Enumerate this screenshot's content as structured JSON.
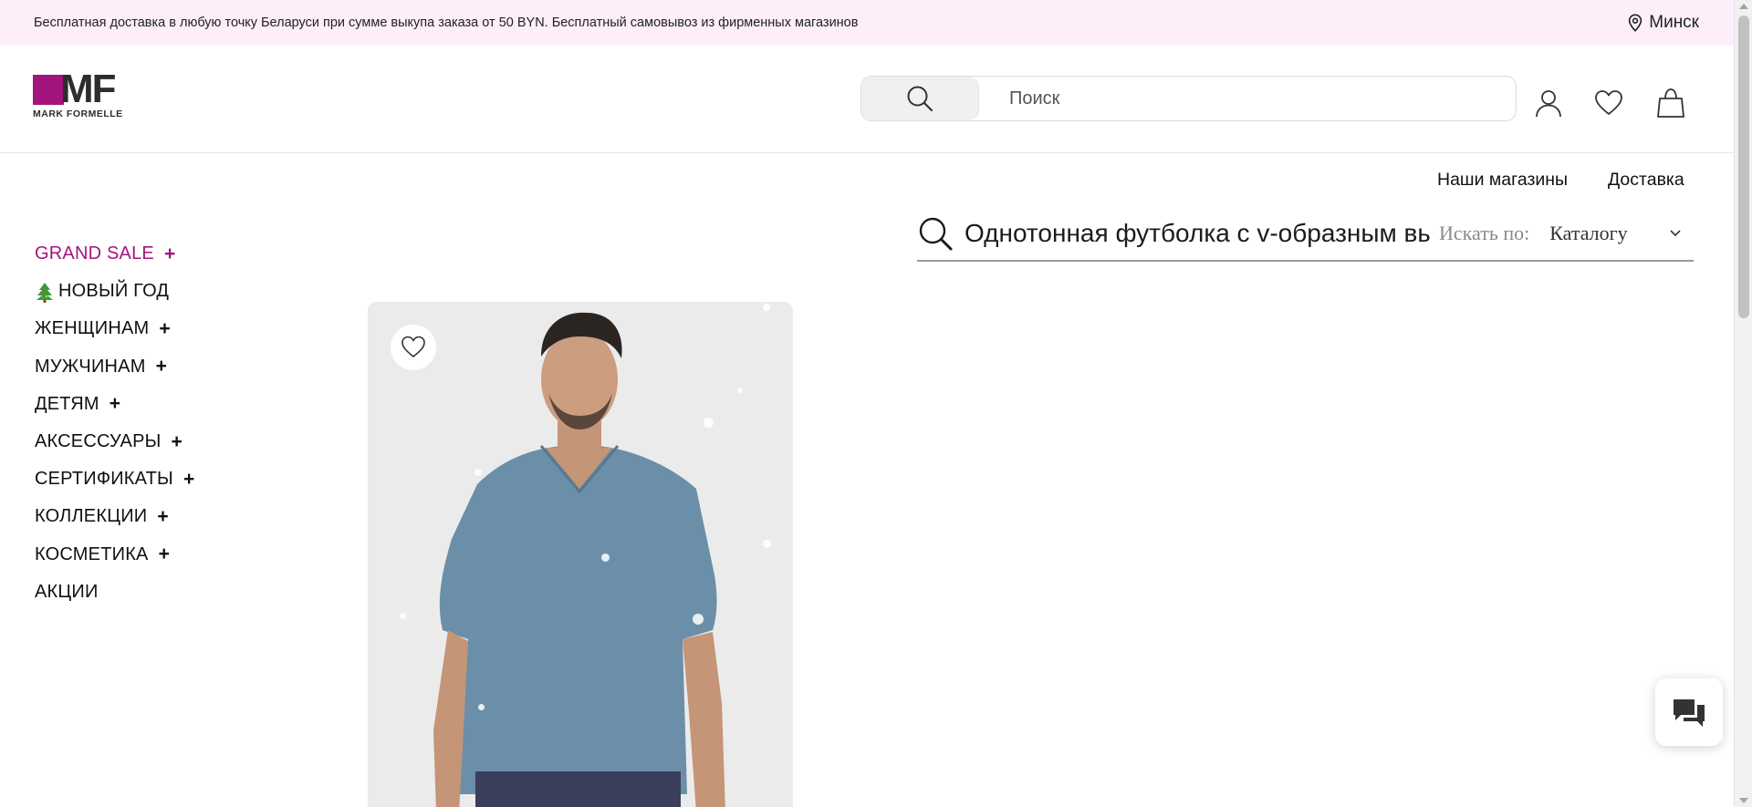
{
  "promo": {
    "text": "Бесплатная доставка в любую точку Беларуси при сумме выкупа заказа от 50 BYN. Бесплатный самовывоз из фирменных магазинов",
    "city": "Минск"
  },
  "logo": {
    "mark": "MF",
    "name": "MARK FORMELLE"
  },
  "header": {
    "search_placeholder": "Поиск",
    "icons": [
      "search-icon",
      "user-icon",
      "heart-icon",
      "shopping-bag-icon"
    ]
  },
  "secondary_links": {
    "stores": "Наши магазины",
    "delivery": "Доставка"
  },
  "nav": {
    "items": [
      {
        "label": "GRAND SALE",
        "plus": "+"
      },
      {
        "label": "НОВЫЙ ГОД",
        "plus": ""
      },
      {
        "label": "ЖЕНЩИНАМ",
        "plus": "+"
      },
      {
        "label": "МУЖЧИНАМ",
        "plus": "+"
      },
      {
        "label": "ДЕТЯМ",
        "plus": "+"
      },
      {
        "label": "АКСЕССУАРЫ",
        "plus": "+"
      },
      {
        "label": "СЕРТИФИКАТЫ",
        "plus": "+"
      },
      {
        "label": "КОЛЛЕКЦИИ",
        "plus": "+"
      },
      {
        "label": "КОСМЕТИКА",
        "plus": "+"
      },
      {
        "label": "АКЦИИ",
        "plus": ""
      }
    ]
  },
  "catalog_search": {
    "query": "Однотонная футболка с v-образным вы",
    "search_by_label": "Искать по:",
    "search_by_value": "Каталогу"
  },
  "colors": {
    "brand": "#a3157d",
    "promo_bg": "#fdeefa",
    "shirt": "#6b8fa8"
  }
}
